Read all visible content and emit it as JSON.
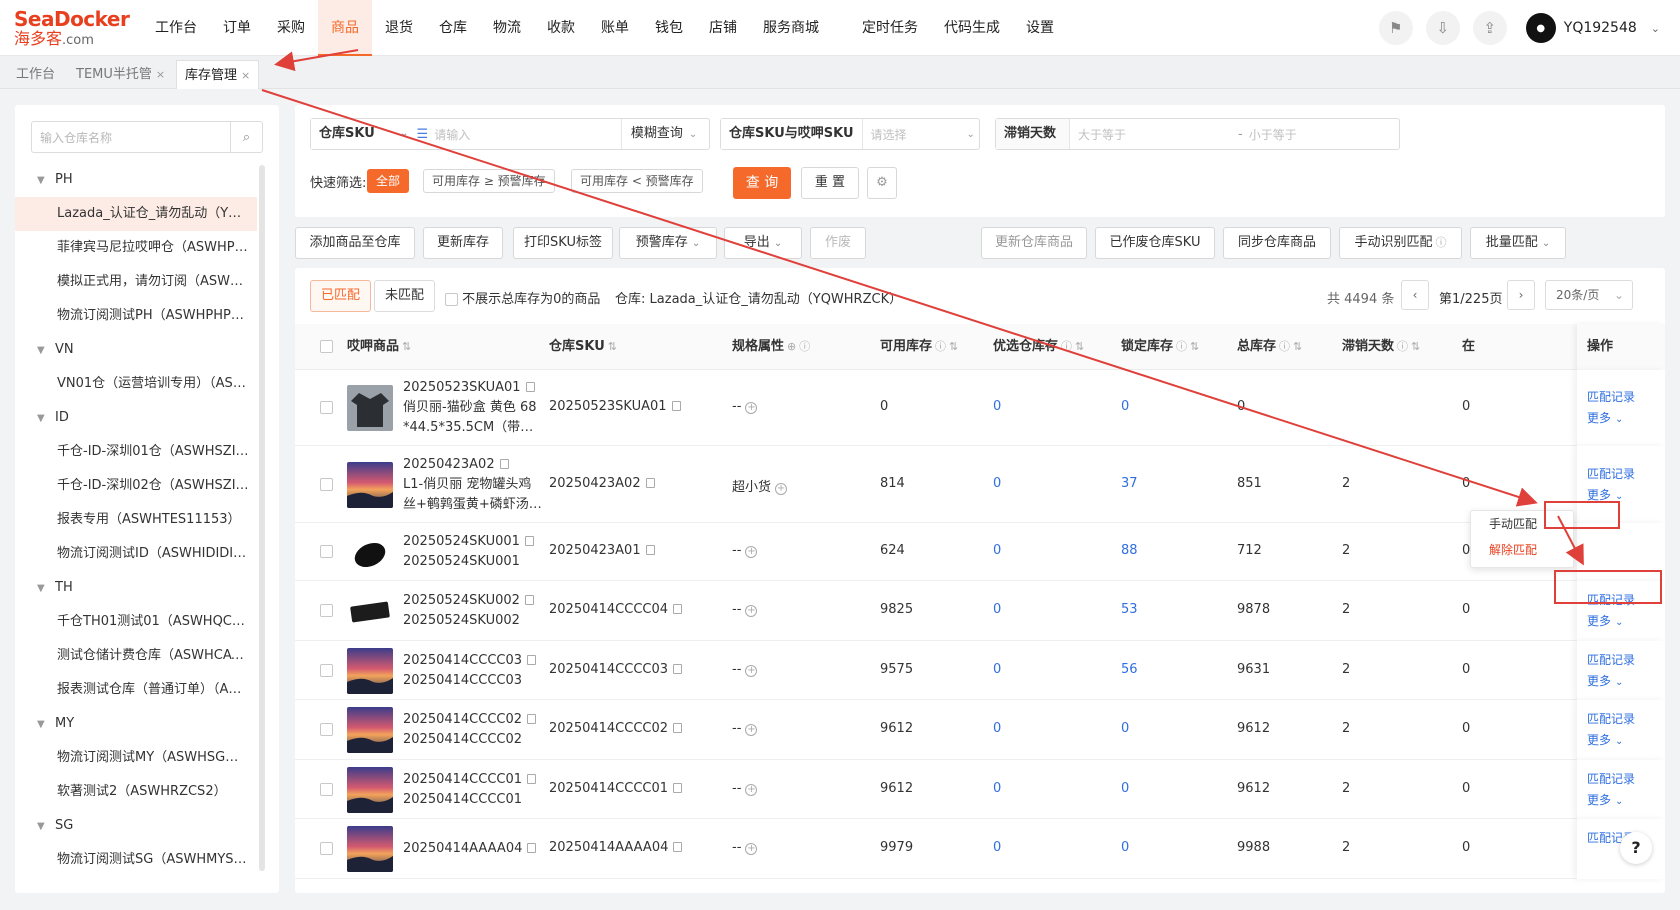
{
  "brand": {
    "logo_top": "SeaDocker",
    "logo_bottom": "海多客",
    "logo_domain": ".com"
  },
  "nav": [
    {
      "label": "工作台"
    },
    {
      "label": "订单"
    },
    {
      "label": "采购"
    },
    {
      "label": "商品",
      "active": true
    },
    {
      "label": "退货"
    },
    {
      "label": "仓库"
    },
    {
      "label": "物流"
    },
    {
      "label": "收款"
    },
    {
      "label": "账单"
    },
    {
      "label": "钱包"
    },
    {
      "label": "店铺"
    },
    {
      "label": "服务商城",
      "badge": "hot"
    },
    {
      "label": "定时任务"
    },
    {
      "label": "代码生成"
    },
    {
      "label": "设置"
    }
  ],
  "user": {
    "name": "YQ192548"
  },
  "tabs": [
    {
      "label": "工作台"
    },
    {
      "label": "TEMU半托管",
      "closable": true
    },
    {
      "label": "库存管理",
      "closable": true,
      "active": true
    }
  ],
  "sidebar": {
    "search_placeholder": "输入仓库名称",
    "tree": [
      {
        "type": "group",
        "label": "PH"
      },
      {
        "type": "leaf",
        "label": "Lazada_认证仓_请勿乱动（YQWHRZCK）",
        "selected": true
      },
      {
        "type": "leaf",
        "label": "菲律宾马尼拉哎呷仓（ASWHPHMN）"
      },
      {
        "type": "leaf",
        "label": "模拟正式用，请勿订阅（ASWHPHZS）"
      },
      {
        "type": "leaf",
        "label": "物流订阅测试PH（ASWHPHPHWL）"
      },
      {
        "type": "group",
        "label": "VN"
      },
      {
        "type": "leaf",
        "label": "VN01仓（运营培训专用）（ASWHVN01）"
      },
      {
        "type": "group",
        "label": "ID"
      },
      {
        "type": "leaf",
        "label": "千仓-ID-深圳01仓（ASWHSZID01）"
      },
      {
        "type": "leaf",
        "label": "千仓-ID-深圳02仓（ASWHSZID02）"
      },
      {
        "type": "leaf",
        "label": "报表专用（ASWHTES11153）"
      },
      {
        "type": "leaf",
        "label": "物流订阅测试ID（ASWHIDIDIWL）"
      },
      {
        "type": "group",
        "label": "TH"
      },
      {
        "type": "leaf",
        "label": "千仓TH01测试01（ASWHQCTH01）"
      },
      {
        "type": "leaf",
        "label": "测试仓储计费仓库（ASWHCATH01）"
      },
      {
        "type": "leaf",
        "label": "报表测试仓库（普通订单）（ASWHTH02）"
      },
      {
        "type": "group",
        "label": "MY"
      },
      {
        "type": "leaf",
        "label": "物流订阅测试MY（ASWHSGMYWL）"
      },
      {
        "type": "leaf",
        "label": "软著测试2（ASWHRZCS2）"
      },
      {
        "type": "group",
        "label": "SG"
      },
      {
        "type": "leaf",
        "label": "物流订阅测试SG（ASWHMYSGWL）"
      }
    ]
  },
  "filters": {
    "sku_label": "仓库SKU",
    "sku_placeholder": "请输入",
    "match_mode": "模糊查询",
    "sku_map_label": "仓库SKU与哎呷SKU",
    "sku_map_placeholder": "请选择",
    "slow_label": "滞销天数",
    "slow_min_placeholder": "大于等于",
    "slow_sep": "-",
    "slow_max_placeholder": "小于等于",
    "quick_label": "快速筛选:",
    "quick": [
      {
        "label": "全部",
        "active": true
      },
      {
        "label": "可用库存 ≥ 预警库存"
      },
      {
        "label": "可用库存 < 预警库存"
      }
    ],
    "search_btn": "查 询",
    "reset_btn": "重 置"
  },
  "toolbar": {
    "left": [
      "添加商品至仓库",
      "更新库存",
      "打印SKU标签",
      "预警库存",
      "导出",
      "作废"
    ],
    "right": [
      "更新仓库商品",
      "已作废仓库SKU",
      "同步仓库商品",
      "手动识别匹配",
      "批量匹配"
    ]
  },
  "table": {
    "tabs": [
      {
        "label": "已匹配",
        "active": true
      },
      {
        "label": "未匹配"
      }
    ],
    "hide_zero_label": "不展示总库存为0的商品",
    "warehouse_prefix": "仓库:",
    "warehouse_name": "Lazada_认证仓_请勿乱动（YQWHRZCK）",
    "total": "共 4494 条",
    "page": "第1/225页",
    "page_size": "20条/页",
    "columns": [
      "哎呷商品",
      "仓库SKU",
      "规格属性",
      "可用库存",
      "优选仓库存",
      "锁定库存",
      "总库存",
      "滞销天数",
      "在",
      "操作"
    ],
    "rows": [
      {
        "line1": "20250523SKUA01",
        "line2": "俏贝丽-猫砂盒 黄色 68",
        "line3": "*44.5*35.5CM（带猫…",
        "sku": "20250523SKUA01",
        "spec": "--",
        "avail": "0",
        "pref": "0",
        "locked": "0",
        "total": "0",
        "slow": "",
        "extra": "0",
        "op1": "匹配记录",
        "op2": "更多",
        "img": "shirt"
      },
      {
        "line1": "20250423A02",
        "line2": "L1-俏贝丽 宠物罐头鸡",
        "line3": "丝+鹌鹑蛋黄+磷虾汤…",
        "sku": "20250423A02",
        "spec": "超小货",
        "avail": "814",
        "pref": "0",
        "locked": "37",
        "total": "851",
        "slow": "2",
        "extra": "0",
        "op1": "匹配记录",
        "op2": "更多",
        "img": "sunset"
      },
      {
        "line1": "20250524SKU001",
        "line2": "20250524SKU001",
        "line3": "",
        "sku": "20250423A01",
        "spec": "--",
        "avail": "624",
        "pref": "0",
        "locked": "88",
        "total": "712",
        "slow": "2",
        "extra": "0",
        "op1": "",
        "op2": "",
        "img": "mouse"
      },
      {
        "line1": "20250524SKU002",
        "line2": "20250524SKU002",
        "line3": "",
        "sku": "20250414CCCC04",
        "spec": "--",
        "avail": "9825",
        "pref": "0",
        "locked": "53",
        "total": "9878",
        "slow": "2",
        "extra": "0",
        "op1": "匹配记录",
        "op2": "更多",
        "img": "keyboard"
      },
      {
        "line1": "20250414CCCC03",
        "line2": "20250414CCCC03",
        "line3": "",
        "sku": "20250414CCCC03",
        "spec": "--",
        "avail": "9575",
        "pref": "0",
        "locked": "56",
        "total": "9631",
        "slow": "2",
        "extra": "0",
        "op1": "匹配记录",
        "op2": "更多",
        "img": "sunset"
      },
      {
        "line1": "20250414CCCC02",
        "line2": "20250414CCCC02",
        "line3": "",
        "sku": "20250414CCCC02",
        "spec": "--",
        "avail": "9612",
        "pref": "0",
        "locked": "0",
        "total": "9612",
        "slow": "2",
        "extra": "0",
        "op1": "匹配记录",
        "op2": "更多",
        "img": "sunset"
      },
      {
        "line1": "20250414CCCC01",
        "line2": "20250414CCCC01",
        "line3": "",
        "sku": "20250414CCCC01",
        "spec": "--",
        "avail": "9612",
        "pref": "0",
        "locked": "0",
        "total": "9612",
        "slow": "2",
        "extra": "0",
        "op1": "匹配记录",
        "op2": "更多",
        "img": "sunset"
      },
      {
        "line1": "20250414AAAA04",
        "line2": "",
        "line3": "",
        "sku": "20250414AAAA04",
        "spec": "--",
        "avail": "9979",
        "pref": "0",
        "locked": "0",
        "total": "9988",
        "slow": "2",
        "extra": "0",
        "op1": "匹配记录",
        "op2": "",
        "img": "sunset"
      }
    ]
  },
  "dropdown": {
    "items": [
      "手动匹配",
      "解除匹配"
    ]
  },
  "help": "?",
  "colors": {
    "accent": "#f56a2b",
    "link": "#2f6fe0",
    "annotation": "#e0403a"
  },
  "icons": [
    "search-icon",
    "pin-icon",
    "download-icon",
    "share-icon",
    "copy-icon",
    "plus-circle-icon",
    "help-circle-icon",
    "sort-icon",
    "gear-icon",
    "chevron-down-icon"
  ]
}
